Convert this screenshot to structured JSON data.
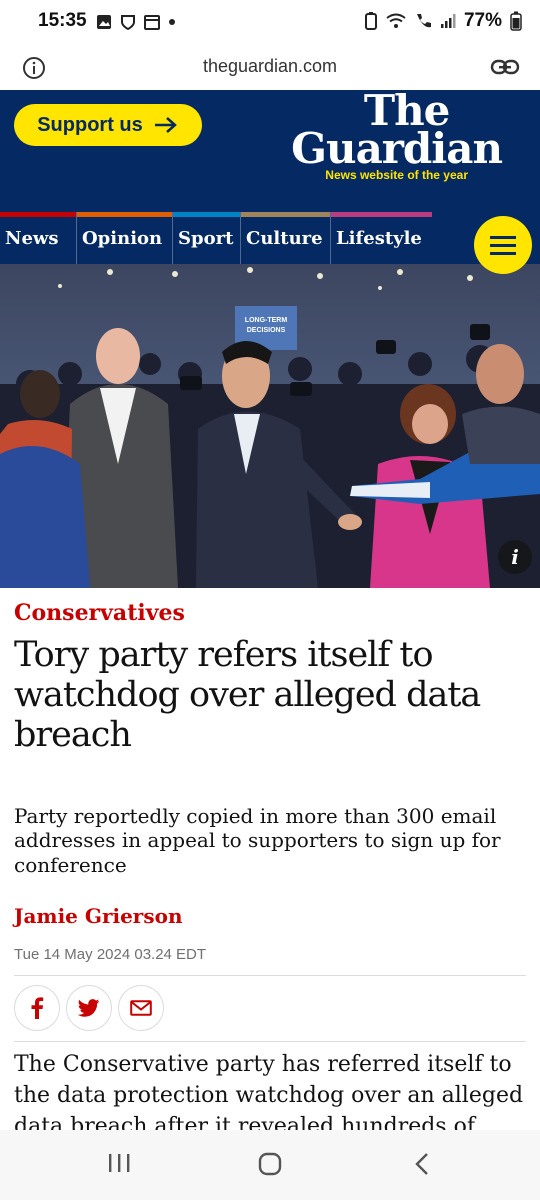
{
  "status_bar": {
    "time": "15:35",
    "battery": "77%"
  },
  "browser": {
    "url": "theguardian.com"
  },
  "header": {
    "support_label": "Support us",
    "logo_line1": "The",
    "logo_line2": "Guardian",
    "tagline": "News website of the year"
  },
  "nav": {
    "items": [
      {
        "label": "News",
        "color": "#c70000"
      },
      {
        "label": "Opinion",
        "color": "#e05e00"
      },
      {
        "label": "Sport",
        "color": "#0084c6"
      },
      {
        "label": "Culture",
        "color": "#a1845c"
      },
      {
        "label": "Lifestyle",
        "color": "#bb3b80"
      }
    ],
    "menu_icon": "hamburger-icon"
  },
  "hero_image": {
    "backdrop_sign": "LONG-TERM DECISIONS",
    "info_icon": "i"
  },
  "article": {
    "kicker": "Conservatives",
    "headline": "Tory party refers itself to watchdog over alleged data breach",
    "standfirst": "Party reportedly copied in more than 300 email addresses in appeal to supporters to sign up for conference",
    "byline": "Jamie Grierson",
    "date": "Tue 14 May 2024 03.24 EDT",
    "share_buttons": [
      "facebook-icon",
      "twitter-icon",
      "email-icon"
    ],
    "body": "The Conservative party has referred itself to the data protection watchdog over an alleged data breach after it revealed hundreds of"
  },
  "colors": {
    "brand_blue": "#052962",
    "yellow": "#ffe500",
    "red": "#c70000"
  }
}
